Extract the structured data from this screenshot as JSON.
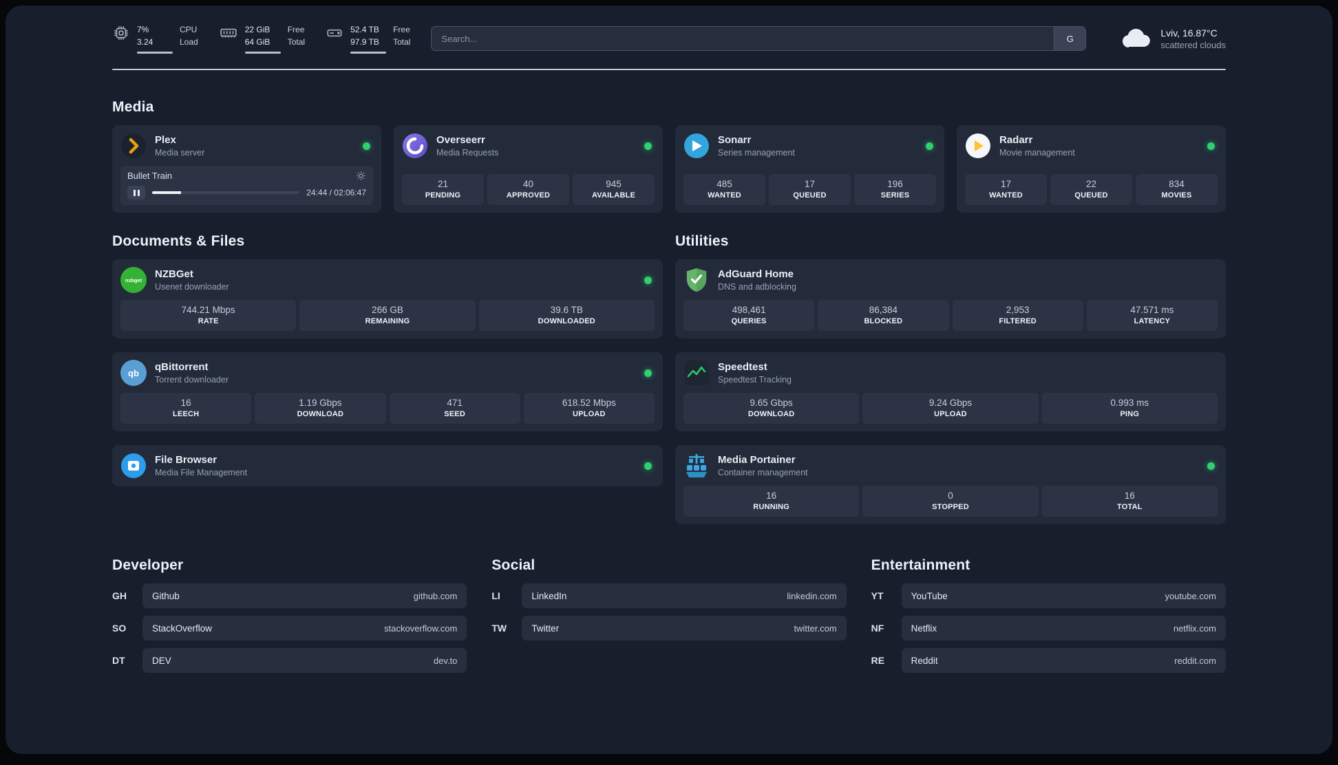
{
  "colors": {
    "status_green": "#2fd06f",
    "plex_amber": "#e5a00d",
    "radarr_yellow": "#ffc230",
    "sonarr_blue": "#33a4dc",
    "overseerr_purple": "#6a58d0",
    "nzbget_green": "#34b233",
    "qbittorrent_blue": "#5a9fd4",
    "adguard_green": "#68b36b",
    "portainer_blue": "#3ba8e0",
    "filebrowser_blue": "#2e9ced"
  },
  "topbar": {
    "cpu": {
      "value1": "7%",
      "value2": "3.24",
      "label1": "CPU",
      "label2": "Load"
    },
    "memory": {
      "value1": "22 GiB",
      "value2": "64 GiB",
      "label1": "Free",
      "label2": "Total"
    },
    "disk": {
      "value1": "52.4 TB",
      "value2": "97.9 TB",
      "label1": "Free",
      "label2": "Total"
    },
    "search": {
      "placeholder": "Search...",
      "button": "G"
    },
    "weather": {
      "location": "Lviv, 16.87°C",
      "condition": "scattered clouds"
    }
  },
  "media": {
    "title": "Media",
    "plex": {
      "name": "Plex",
      "subtitle": "Media server",
      "now_playing": "Bullet Train",
      "time": "24:44 / 02:06:47"
    },
    "cards": [
      {
        "name": "Overseerr",
        "subtitle": "Media Requests",
        "stats": [
          {
            "value": "21",
            "label": "PENDING"
          },
          {
            "value": "40",
            "label": "APPROVED"
          },
          {
            "value": "945",
            "label": "AVAILABLE"
          }
        ]
      },
      {
        "name": "Sonarr",
        "subtitle": "Series management",
        "stats": [
          {
            "value": "485",
            "label": "WANTED"
          },
          {
            "value": "17",
            "label": "QUEUED"
          },
          {
            "value": "196",
            "label": "SERIES"
          }
        ]
      },
      {
        "name": "Radarr",
        "subtitle": "Movie management",
        "stats": [
          {
            "value": "17",
            "label": "WANTED"
          },
          {
            "value": "22",
            "label": "QUEUED"
          },
          {
            "value": "834",
            "label": "MOVIES"
          }
        ]
      }
    ]
  },
  "documents": {
    "title": "Documents & Files",
    "cards": [
      {
        "name": "NZBGet",
        "subtitle": "Usenet downloader",
        "icon_text": "nzbget",
        "stats": [
          {
            "value": "744.21 Mbps",
            "label": "RATE"
          },
          {
            "value": "266 GB",
            "label": "REMAINING"
          },
          {
            "value": "39.6 TB",
            "label": "DOWNLOADED"
          }
        ]
      },
      {
        "name": "qBittorrent",
        "subtitle": "Torrent downloader",
        "icon_text": "qb",
        "stats": [
          {
            "value": "16",
            "label": "LEECH"
          },
          {
            "value": "1.19 Gbps",
            "label": "DOWNLOAD"
          },
          {
            "value": "471",
            "label": "SEED"
          },
          {
            "value": "618.52 Mbps",
            "label": "UPLOAD"
          }
        ]
      },
      {
        "name": "File Browser",
        "subtitle": "Media File Management",
        "stats": []
      }
    ]
  },
  "utilities": {
    "title": "Utilities",
    "cards": [
      {
        "name": "AdGuard Home",
        "subtitle": "DNS and adblocking",
        "stats": [
          {
            "value": "498,461",
            "label": "QUERIES"
          },
          {
            "value": "86,384",
            "label": "BLOCKED"
          },
          {
            "value": "2,953",
            "label": "FILTERED"
          },
          {
            "value": "47.571 ms",
            "label": "LATENCY"
          }
        ]
      },
      {
        "name": "Speedtest",
        "subtitle": "Speedtest Tracking",
        "stats": [
          {
            "value": "9.65 Gbps",
            "label": "DOWNLOAD"
          },
          {
            "value": "9.24 Gbps",
            "label": "UPLOAD"
          },
          {
            "value": "0.993 ms",
            "label": "PING"
          }
        ]
      },
      {
        "name": "Media Portainer",
        "subtitle": "Container management",
        "stats": [
          {
            "value": "16",
            "label": "RUNNING"
          },
          {
            "value": "0",
            "label": "STOPPED"
          },
          {
            "value": "16",
            "label": "TOTAL"
          }
        ]
      }
    ]
  },
  "bookmarks": [
    {
      "title": "Developer",
      "items": [
        {
          "abbr": "GH",
          "name": "Github",
          "url": "github.com"
        },
        {
          "abbr": "SO",
          "name": "StackOverflow",
          "url": "stackoverflow.com"
        },
        {
          "abbr": "DT",
          "name": "DEV",
          "url": "dev.to"
        }
      ]
    },
    {
      "title": "Social",
      "items": [
        {
          "abbr": "LI",
          "name": "LinkedIn",
          "url": "linkedin.com"
        },
        {
          "abbr": "TW",
          "name": "Twitter",
          "url": "twitter.com"
        }
      ]
    },
    {
      "title": "Entertainment",
      "items": [
        {
          "abbr": "YT",
          "name": "YouTube",
          "url": "youtube.com"
        },
        {
          "abbr": "NF",
          "name": "Netflix",
          "url": "netflix.com"
        },
        {
          "abbr": "RE",
          "name": "Reddit",
          "url": "reddit.com"
        }
      ]
    }
  ]
}
